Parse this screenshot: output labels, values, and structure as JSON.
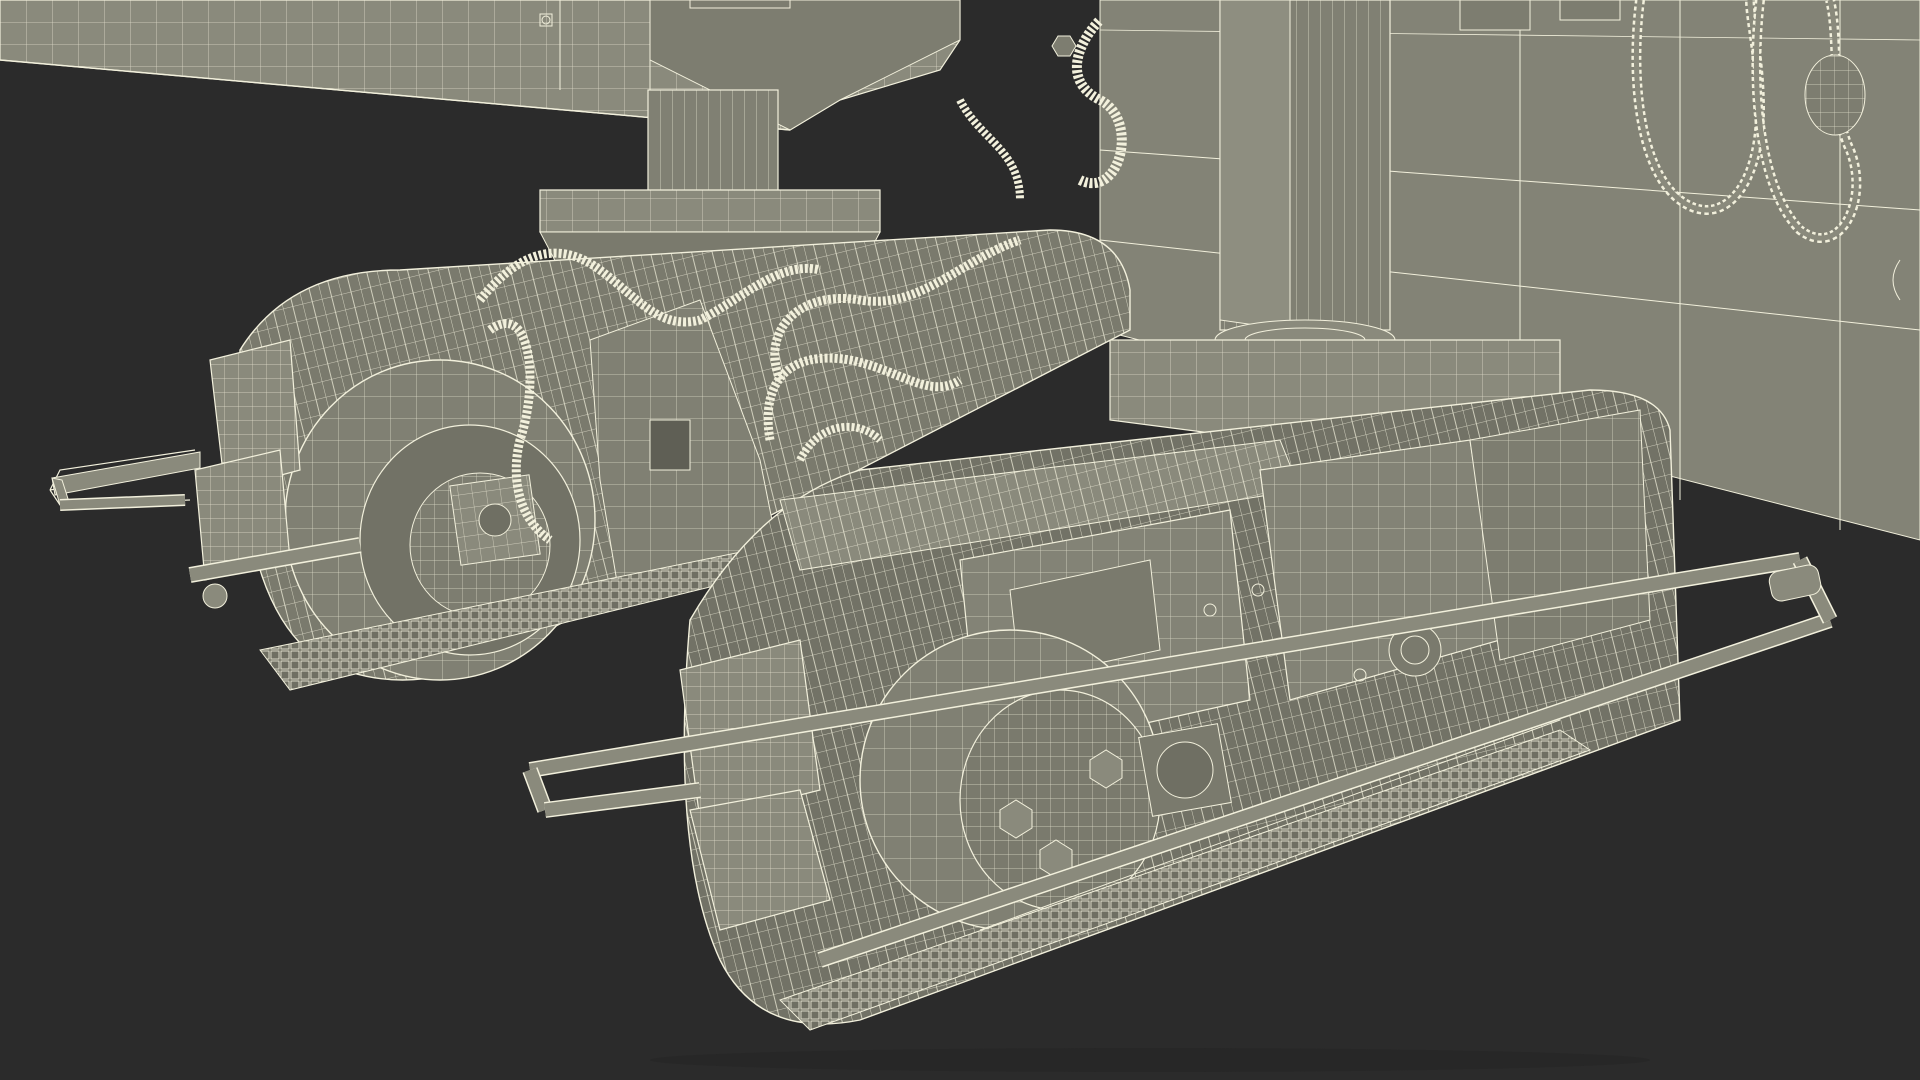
{
  "scene": {
    "background_color": "#2b2b2b",
    "model_fill_color": "#8a8a7c",
    "model_shadow_color": "#6f6f63",
    "model_highlight_color": "#a8a898",
    "wireframe_color": "#f2f0dc"
  }
}
